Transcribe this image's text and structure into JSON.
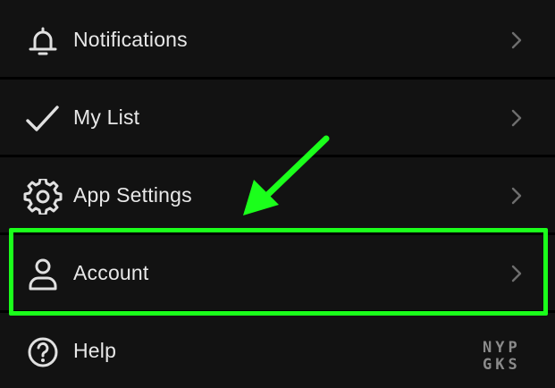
{
  "colors": {
    "background": "#121212",
    "text": "#e8e8e8",
    "icon": "#e0e0e0",
    "chevron": "#6e6e6e",
    "highlight": "#1bff1b"
  },
  "menu": {
    "items": [
      {
        "label": "Notifications",
        "icon": "bell-icon"
      },
      {
        "label": "My List",
        "icon": "checkmark-icon"
      },
      {
        "label": "App Settings",
        "icon": "gear-icon"
      },
      {
        "label": "Account",
        "icon": "person-icon"
      },
      {
        "label": "Help",
        "icon": "help-circle-icon"
      }
    ]
  },
  "annotation": {
    "highlighted_item": "Account",
    "arrow": "arrow-icon"
  },
  "watermark": {
    "line1": "NYP",
    "line2": "GKS"
  }
}
